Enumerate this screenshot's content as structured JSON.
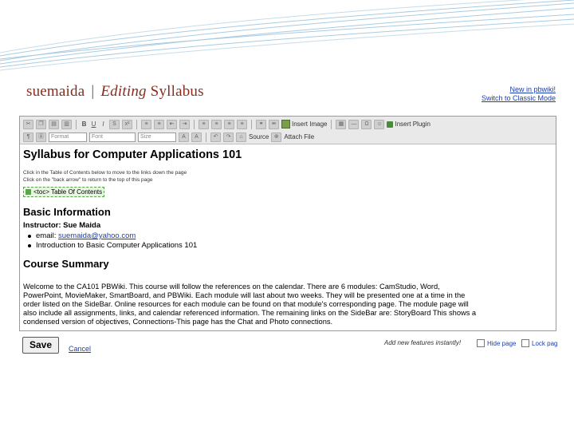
{
  "header": {
    "site": "suemaida",
    "editing": "Editing",
    "page_name": "Syllabus",
    "links": [
      "New in pbwiki!",
      "Switch to Classic Mode"
    ]
  },
  "toolbar": {
    "row1": {
      "buttons": [
        "B",
        "U",
        "I"
      ],
      "insert_image": "Insert Image",
      "insert_plugin": "Insert Plugin"
    },
    "row2": {
      "format": "Format",
      "font": "Font",
      "size": "Size",
      "source": "Source",
      "attach_file": "Attach File"
    }
  },
  "content": {
    "title": "Syllabus for Computer Applications 101",
    "hint1": "Click in the Table of Contents below to move to the links down the page",
    "hint2": "Click on the \"back arrow\" to return to the top of this page",
    "toc": "<toc> Table Of Contents",
    "basic_heading": "Basic Information",
    "instructor_label": "Instructor:",
    "instructor_name": "Sue Maida",
    "email_label": "email:",
    "email": "suemaida@yahoo.com",
    "intro": "Introduction to Basic Computer Applications 101",
    "summary_heading": "Course Summary",
    "summary_lines": [
      "Welcome to the CA101 PBWiki. This course will follow the references on the calendar. There are 6 modules: CamStudio, Word,",
      "PowerPoint, MovieMaker, SmartBoard, and PBWiki. Each module will last about two weeks. They will be presented one at a time in the",
      "order listed on the SideBar. Online resources for each module can be found on that module's corresponding page. The module page will",
      "also include all assignments, links, and calendar referenced information. The remaining links on the SideBar are: StoryBoard This shows a",
      "condensed version of objectives, Connections-This page has the Chat and Photo connections."
    ]
  },
  "footer": {
    "save": "Save",
    "cancel": "Cancel",
    "new_features": "Add new features instantly!",
    "hide_page": "Hide page",
    "lock_page": "Lock pag"
  },
  "colors": {
    "brand": "#8b2b1c",
    "link": "#1a3fb0",
    "toolbar_bg": "#e9e9e9",
    "deco_lines": "#a9cbe0"
  }
}
